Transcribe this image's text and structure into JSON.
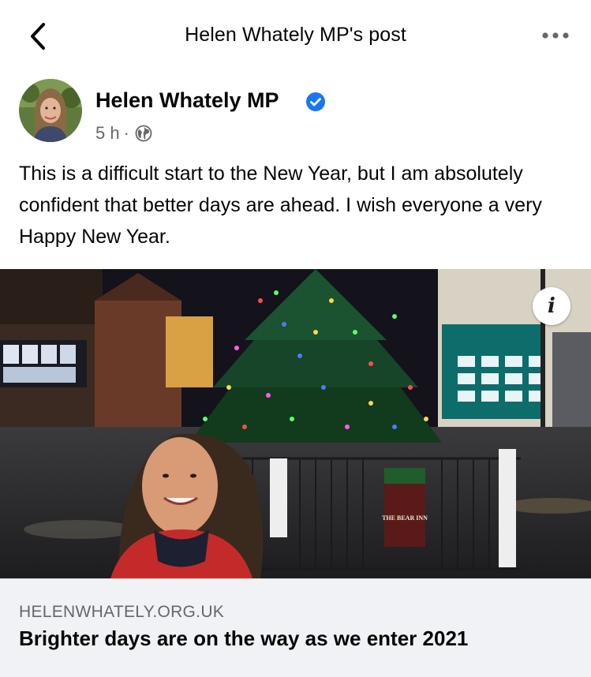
{
  "header": {
    "title": "Helen Whately MP's post",
    "back_icon": "chevron-left-icon",
    "more_icon": "more-horizontal-icon"
  },
  "post": {
    "author": "Helen Whately MP",
    "verified": true,
    "time": "5 h",
    "separator": "·",
    "audience_icon": "globe-icon",
    "text": "This is a difficult start to the New Year, but I am absolutely confident that better days are ahead. I wish everyone a very Happy New Year."
  },
  "link_preview": {
    "domain": "HELENWHATELY.ORG.UK",
    "title": "Brighter days are on the way as we enter 2021",
    "info_label": "i",
    "sign_text": "THE BEAR INN"
  },
  "colors": {
    "verified": "#1877f2",
    "secondary_text": "#65676b",
    "card_background": "#f0f2f5"
  }
}
